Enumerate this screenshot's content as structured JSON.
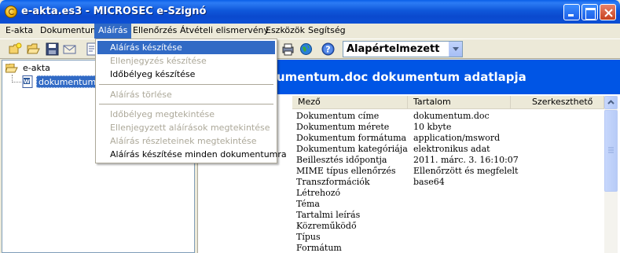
{
  "window": {
    "title": "e-akta.es3 - MICROSEC e-Szignó"
  },
  "menubar": [
    {
      "label": "E-akta"
    },
    {
      "label": "Dokumentum"
    },
    {
      "label": "Aláírás"
    },
    {
      "label": "Ellenőrzés"
    },
    {
      "label": "Átvételi elismervény"
    },
    {
      "label": "Eszközök"
    },
    {
      "label": "Segítség"
    }
  ],
  "toolbar": {
    "profile_select": "Alapértelmezett"
  },
  "tree": {
    "root_label": "e-akta",
    "child_label": "dokumentum.doc"
  },
  "details": {
    "banner": "umentum.doc dokumentum adatlapja",
    "columns": [
      "Mező",
      "Tartalom",
      "Szerkeszthető"
    ],
    "rows": [
      {
        "field": "Dokumentum címe",
        "value": "dokumentum.doc"
      },
      {
        "field": "Dokumentum mérete",
        "value": "10 kbyte"
      },
      {
        "field": "Dokumentum formátuma",
        "value": "application/msword"
      },
      {
        "field": "Dokumentum kategóriája",
        "value": "elektronikus adat"
      },
      {
        "field": "Beillesztés időpontja",
        "value": "2011. márc. 3. 16:10:07"
      },
      {
        "field": "MIME típus ellenőrzés",
        "value": "Ellenőrzött és megfelelt"
      },
      {
        "field": "Transzformációk",
        "value": "base64"
      },
      {
        "field": "Létrehozó",
        "value": ""
      },
      {
        "field": "Téma",
        "value": ""
      },
      {
        "field": "Tartalmi leírás",
        "value": ""
      },
      {
        "field": "Közreműködő",
        "value": ""
      },
      {
        "field": "Típus",
        "value": ""
      },
      {
        "field": "Formátum",
        "value": ""
      }
    ]
  },
  "dropdown": {
    "items": [
      {
        "label": "Aláírás készítése",
        "state": "selected"
      },
      {
        "label": "Ellenjegyzés készítése",
        "state": "disabled"
      },
      {
        "label": "Időbélyeg készítése",
        "state": "enabled"
      },
      {
        "label": "Aláírás törlése",
        "state": "disabled"
      },
      {
        "label": "Időbélyeg megtekintése",
        "state": "disabled"
      },
      {
        "label": "Ellenjegyzett aláírások megtekintése",
        "state": "disabled"
      },
      {
        "label": "Aláírás részleteinek megtekintése",
        "state": "disabled"
      },
      {
        "label": "Aláírás készítése minden dokumentumra",
        "state": "enabled"
      }
    ]
  },
  "colors": {
    "titlebar": "#0A49CE",
    "selection": "#316AC5",
    "banner": "#0055E5",
    "chrome": "#ECE9D8"
  }
}
